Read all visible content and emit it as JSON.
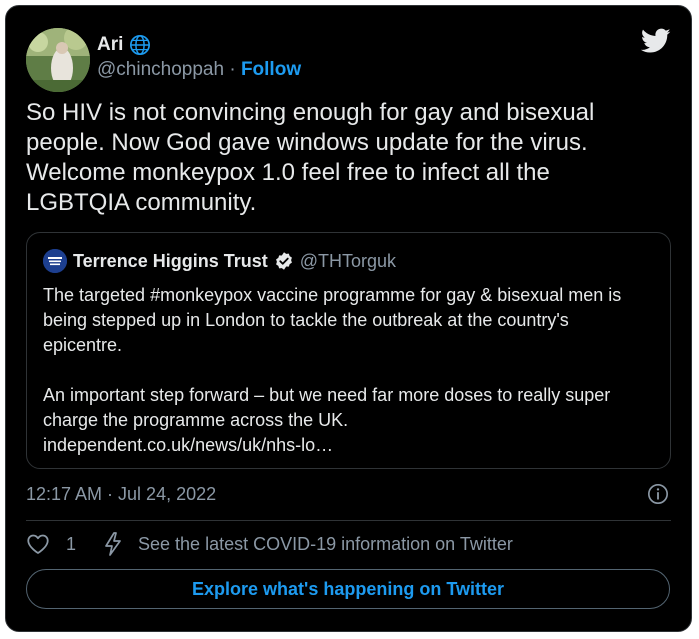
{
  "tweet": {
    "author": {
      "name": "Ari",
      "handle": "@chinchoppah",
      "separator": "·",
      "follow_label": "Follow",
      "avatar": "avatar-photo",
      "badge_icon": "globe-icon"
    },
    "logo_icon": "twitter-bird-icon",
    "text": "So HIV is not convincing enough for gay and bisexual\npeople. Now God gave windows update for the virus.\nWelcome monkeypox 1.0 feel free to infect all the\nLGBTQIA community.",
    "quoted_tweet": {
      "author_name": "Terrence Higgins Trust",
      "author_handle": "@THTorguk",
      "verified_icon": "verified-badge-icon",
      "text": "The targeted #monkeypox vaccine programme for gay & bisexual men is\nbeing stepped up in London to tackle the outbreak at the country's\nepicentre.\n\nAn important step forward – but we need far more doses to really super\ncharge the programme across the UK.\nindependent.co.uk/news/uk/nhs-lo…"
    },
    "timestamp": "12:17 AM · Jul 24, 2022",
    "info_icon": "info-icon",
    "actions": {
      "like_count": "1",
      "covid_info_label": "See the latest COVID-19 information on Twitter"
    },
    "explore_label": "Explore what's happening on Twitter"
  },
  "colors": {
    "background": "#000000",
    "text": "#e7e9ea",
    "secondary_text": "#8b98a5",
    "accent": "#1d9bf0",
    "border": "#2f3336"
  }
}
